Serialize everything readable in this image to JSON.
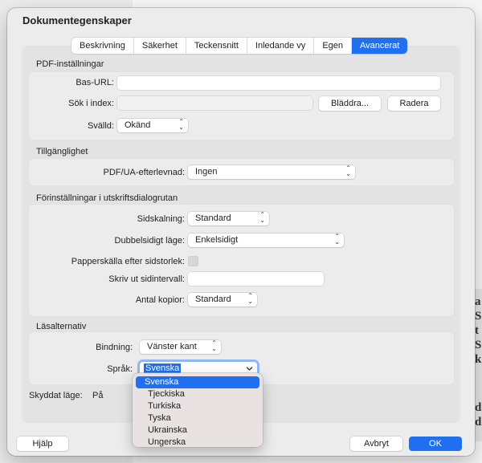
{
  "dialog": {
    "title": "Dokumentegenskaper",
    "tabs": [
      {
        "label": "Beskrivning"
      },
      {
        "label": "Säkerhet"
      },
      {
        "label": "Teckensnitt"
      },
      {
        "label": "Inledande vy"
      },
      {
        "label": "Egen"
      },
      {
        "label": "Avancerat"
      }
    ],
    "active_tab": "Avancerat"
  },
  "pdf_settings": {
    "heading": "PDF-inställningar",
    "base_url_label": "Bas-URL:",
    "base_url_value": "",
    "search_index_label": "Sök i index:",
    "search_index_value": "",
    "browse_button": "Bläddra...",
    "clear_button": "Radera",
    "trapped_label": "Svälld:",
    "trapped_value": "Okänd"
  },
  "accessibility": {
    "heading": "Tillgänglighet",
    "pdfua_label": "PDF/UA-efterlevnad:",
    "pdfua_value": "Ingen"
  },
  "print_presets": {
    "heading": "Förinställningar i utskriftsdialogrutan",
    "page_scaling_label": "Sidskalning:",
    "page_scaling_value": "Standard",
    "duplex_label": "Dubbelsidigt läge:",
    "duplex_value": "Enkelsidigt",
    "paper_source_label": "Papperskälla efter sidstorlek:",
    "paper_source_checked": false,
    "print_range_label": "Skriv ut sidintervall:",
    "print_range_value": "",
    "copies_label": "Antal kopior:",
    "copies_value": "Standard"
  },
  "reading_options": {
    "heading": "Läsalternativ",
    "binding_label": "Bindning:",
    "binding_value": "Vänster kant",
    "language_label": "Språk:",
    "language_value": "Svenska"
  },
  "protected_mode": {
    "label": "Skyddat läge:",
    "value": "På"
  },
  "language_dropdown": {
    "options": [
      "Svenska",
      "Tjeckiska",
      "Turkiska",
      "Tyska",
      "Ukrainska",
      "Ungerska"
    ],
    "selected": "Svenska"
  },
  "footer": {
    "help_button": "Hjälp",
    "cancel_button": "Avbryt",
    "ok_button": "OK"
  },
  "background": {
    "glyphs": [
      "a",
      "S",
      "t",
      "S",
      "k",
      "d",
      "d"
    ]
  },
  "colors": {
    "accent": "#1f6ff0",
    "dialog_bg": "#ececec",
    "pane_bg": "#e3e3e3"
  }
}
